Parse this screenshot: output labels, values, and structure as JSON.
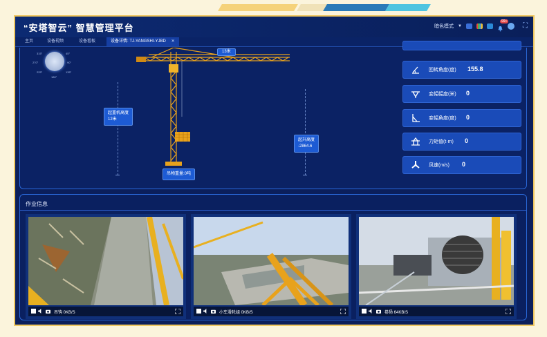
{
  "header": {
    "title": "“安塔智云” 智慧管理平台",
    "theme_mode": "暗色模式",
    "notification_count": "99+"
  },
  "tabs": [
    {
      "label": "主页",
      "active": false
    },
    {
      "label": "设备视频",
      "active": false
    },
    {
      "label": "设备看板",
      "active": false
    },
    {
      "label": "设备详情: TJ-YANGSHI-YJBD",
      "active": true
    }
  ],
  "compass": {
    "labels": [
      "315°",
      "45°",
      "270°",
      "90°",
      "225°",
      "135°",
      "180°"
    ]
  },
  "crane": {
    "jib_length": "13米",
    "boom_height_label": "起重机高度",
    "boom_height_value": "12米",
    "hoist_height_label": "起升高度",
    "hoist_height_value": "-2864.6",
    "load_weight": "吊物重量:0吨"
  },
  "sensors": [
    {
      "icon": "rotation-angle-icon",
      "label": "回转角度(度)",
      "value": "155.8"
    },
    {
      "icon": "luffing-amplitude-icon",
      "label": "变幅幅度(米)",
      "value": "0"
    },
    {
      "icon": "luffing-angle-icon",
      "label": "变幅角度(度)",
      "value": "0"
    },
    {
      "icon": "moment-icon",
      "label": "力矩值(t·m)",
      "value": "0"
    },
    {
      "icon": "wind-speed-icon",
      "label": "风速(m/s)",
      "value": "0"
    }
  ],
  "job": {
    "title": "作业信息",
    "cameras": [
      {
        "name": "吊钩 0KB/S"
      },
      {
        "name": "小车滑轮组 0KB/S"
      },
      {
        "name": "卷扬 64KB/S"
      }
    ]
  },
  "colors": {
    "accent": "#1d5bd4",
    "frame": "#f0c860",
    "background": "#0b1f5c",
    "crane_yellow": "#e8a21c"
  }
}
